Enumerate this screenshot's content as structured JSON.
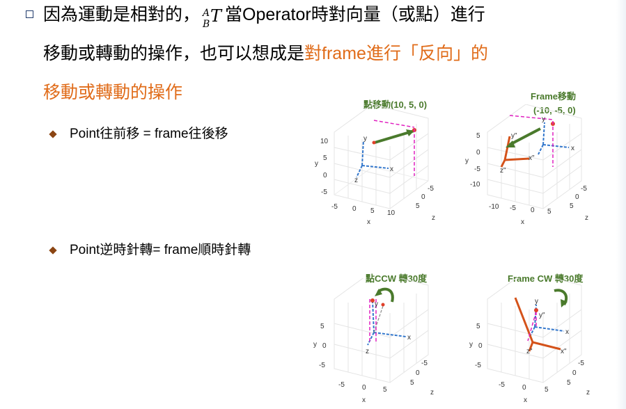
{
  "main": {
    "line1_pre": "因為運動是相對的，",
    "math_sup": "A",
    "math_sub": "B",
    "math_T": "T",
    "line1_mid": "當",
    "line1_operator": "Operator",
    "line1_post": "時對向量（或點）進行",
    "line2_pre": "移動或轉動的操作，也可以想成是",
    "line2_hl1": "對",
    "line2_hl2": "frame",
    "line2_hl3": "進行「反向」的",
    "line3": "移動或轉動的操作"
  },
  "bullets": {
    "b1_en": "Point",
    "b1_zh": "往前移",
    "b1_eq": " = frame",
    "b1_zh2": "往後移",
    "b2_en": "Point",
    "b2_zh": "逆時針轉",
    "b2_eq": "= frame",
    "b2_zh2": "順時針轉"
  },
  "plots": {
    "p1_title": "點移動(10, 5, 0)",
    "p2_title_a": "Frame移動",
    "p2_title_b": "(-10, -5, 0)",
    "p3_title": "點CCW 轉30度",
    "p4_title": "Frame CW 轉30度"
  },
  "axis": {
    "x": "x",
    "y": "y",
    "z": "z",
    "p1_y_ticks": [
      "10",
      "5",
      "0",
      "-5"
    ],
    "p1_x_ticks": [
      "-5",
      "0",
      "5",
      "10"
    ],
    "p1_z_ticks": [
      "-5",
      "0",
      "5"
    ],
    "p2_y_ticks": [
      "5",
      "0",
      "-5",
      "-10"
    ],
    "p2_x_ticks": [
      "-10",
      "-5",
      "0",
      "5"
    ],
    "p2_z_ticks": [
      "-5",
      "0",
      "5"
    ],
    "p3_y_ticks": [
      "5",
      "0",
      "-5"
    ],
    "p3_x_ticks": [
      "-5",
      "0",
      "5"
    ],
    "p3_z_ticks": [
      "-5",
      "0",
      "5"
    ],
    "p4_y_ticks": [
      "5",
      "0",
      "-5"
    ],
    "p4_x_ticks": [
      "-5",
      "0",
      "5"
    ],
    "p4_z_ticks": [
      "-5",
      "0",
      "5"
    ]
  },
  "frame_labels": {
    "xpp": "x\"",
    "ypp": "y\"",
    "zpp": "z\""
  },
  "colors": {
    "orange": "#e06c1a",
    "green": "#4a7a2c",
    "magenta": "#e020c0",
    "axis_blue": "#3377cc",
    "frame_red": "#d4521a"
  }
}
